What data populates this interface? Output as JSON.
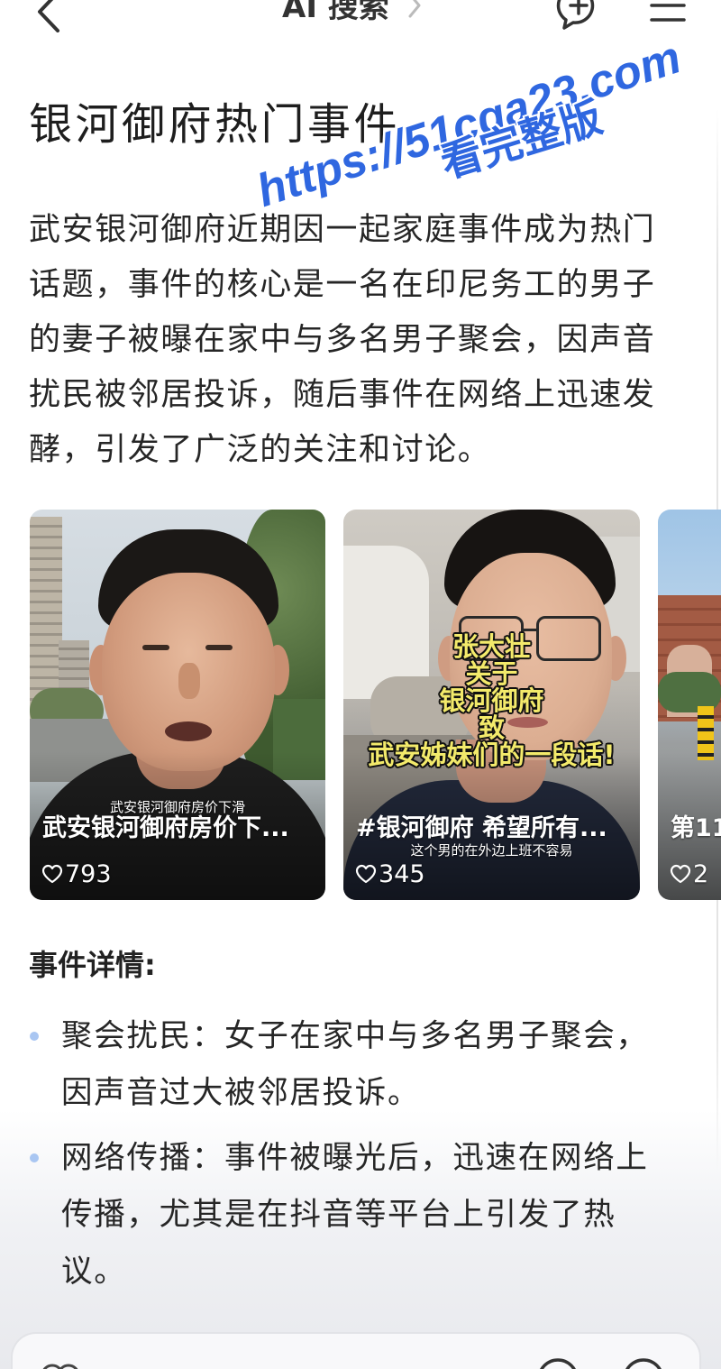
{
  "topbar": {
    "back_icon": "chevron-left-icon",
    "title": "AI 搜索",
    "title_arrow_icon": "chevron-right-icon",
    "new_chat_icon": "chat-plus-icon",
    "menu_icon": "menu-icon"
  },
  "watermark": {
    "line1": "https://51cga23.com",
    "line2": "看完整版",
    "color": "#2f67e0"
  },
  "article": {
    "title": "银河御府热门事件",
    "summary": "武安银河御府近期因一起家庭事件成为热门话题，事件的核心是一名在印尼务工的男子的妻子被曝在家中与多名男子聚会，因声音扰民被邻居投诉，随后事件在网络上迅速发酵，引发了广泛的关注和讨论。"
  },
  "videos": [
    {
      "caption": "武安银河御府房价下...",
      "subtitle": "武安银河御府房价下滑",
      "likes": "793",
      "like_icon": "heart-icon"
    },
    {
      "caption": "#银河御府 希望所有...",
      "subtitle": "这个男的在外边上班不容易",
      "overlay_text": [
        "张大壮",
        "关于",
        "银河御府",
        "致",
        "武安姊妹们的一段话!"
      ],
      "overlay_color": "#f3ea6b",
      "likes": "345",
      "like_icon": "heart-icon"
    },
    {
      "caption": "第11",
      "likes": "2",
      "like_icon": "heart-icon"
    }
  ],
  "details": {
    "heading": "事件详情:",
    "bullet_color": "#a9c6f2",
    "items": [
      {
        "text": "聚会扰民：女子在家中与多名男子聚会，因声音过大被邻居投诉。"
      },
      {
        "text": "网络传播：事件被曝光后，迅速在网络上传播，尤其是在抖音等平台上引发了热议。"
      }
    ]
  },
  "input_bar": {
    "left_icon": "attachment-icon",
    "right_icons": [
      "camera-icon",
      "voice-icon"
    ]
  }
}
